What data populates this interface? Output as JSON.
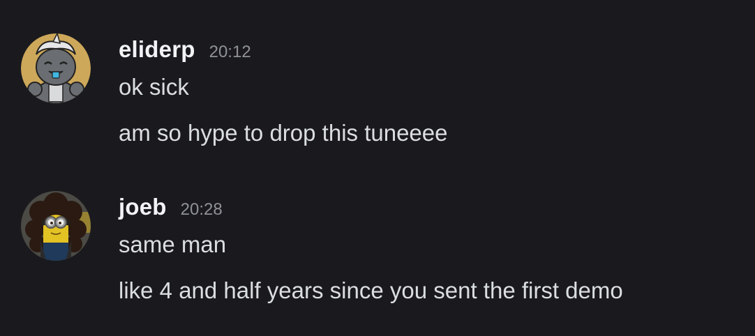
{
  "colors": {
    "background": "#1a1a1e",
    "username": "#f2f3f5",
    "timestamp": "#8e9297",
    "message_text": "#dbdee1"
  },
  "messages": [
    {
      "username": "eliderp",
      "timestamp": "20:12",
      "avatar_icon": "cartoon-creature-avatar",
      "lines": [
        "ok sick",
        "am so hype to drop this tuneeee"
      ]
    },
    {
      "username": "joeb",
      "timestamp": "20:28",
      "avatar_icon": "minion-curly-hair-avatar",
      "lines": [
        "same man",
        "like 4 and half years since you sent the first demo"
      ]
    }
  ]
}
